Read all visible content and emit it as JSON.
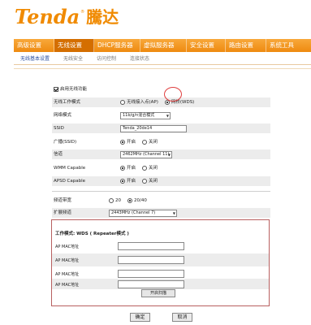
{
  "brand": {
    "logo_en": "Tenda",
    "logo_reg": "®",
    "logo_cn": "騰达",
    "brand_color": "#f08a00"
  },
  "nav": {
    "items": [
      {
        "label": "高级设置"
      },
      {
        "label": "无线设置"
      },
      {
        "label": "DHCP服务器"
      },
      {
        "label": "虚拟服务器"
      },
      {
        "label": "安全设置"
      },
      {
        "label": "路由设置"
      },
      {
        "label": "系统工具"
      }
    ]
  },
  "subnav": {
    "items": [
      {
        "label": "无线基本设置"
      },
      {
        "label": "无线安全"
      },
      {
        "label": "访问控制"
      },
      {
        "label": "连接状态"
      }
    ]
  },
  "form": {
    "enable_label": "启用无线功能",
    "work_mode_label": "无线工作模式",
    "work_mode_opt1": "无线接入点(AP)",
    "work_mode_opt2": "网桥(WDS)",
    "network_mode_label": "网络模式",
    "network_mode_value": "11b/g/n混合模式",
    "ssid_label": "SSID",
    "ssid_value": "Tenda_20de14",
    "broadcast_label": "广播(SSID)",
    "broadcast_on": "开启",
    "broadcast_off": "关闭",
    "channel_label": "信道",
    "channel_value": "2462MHz (Channel 11)",
    "wmm_label": "WMM Capable",
    "wmm_on": "开启",
    "wmm_off": "关闭",
    "apsd_label": "APSD Capable",
    "apsd_on": "开启",
    "apsd_off": "关闭",
    "bandwidth_label": "频道带宽",
    "bandwidth_opt1": "20",
    "bandwidth_opt2": "20/40",
    "ext_channel_label": "扩展频道",
    "ext_channel_value": "2443MHz (Channel 7)"
  },
  "wds": {
    "title": "工作模式: WDS ( Repeater模式 )",
    "mac_labels": [
      "AP MAC地址",
      "AP MAC地址",
      "AP MAC地址",
      "AP MAC地址"
    ],
    "scan_label": "开启扫描"
  },
  "actions": {
    "ok_label": "确定",
    "cancel_label": "取消"
  }
}
